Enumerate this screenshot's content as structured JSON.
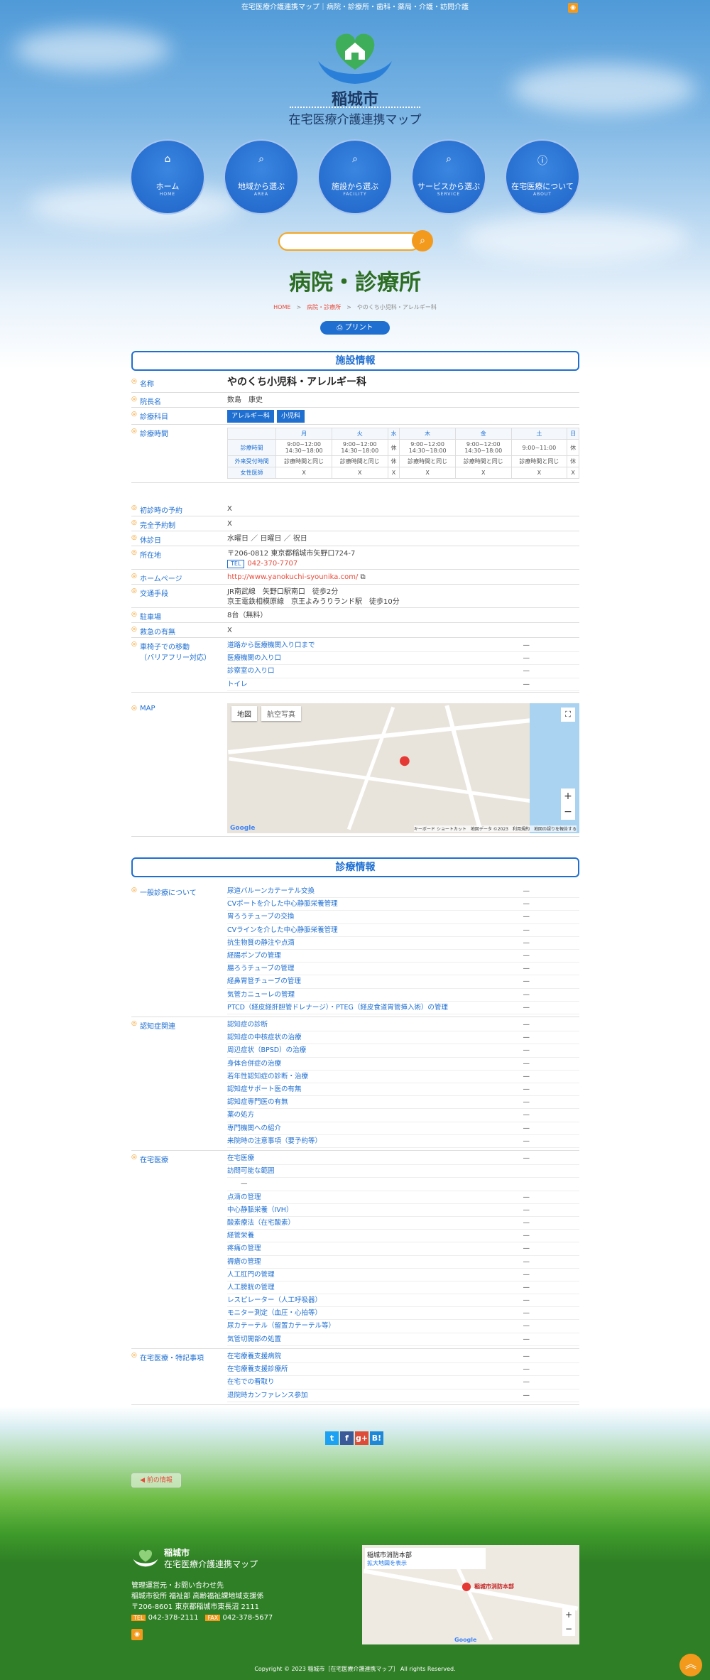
{
  "header": {
    "tagline": "在宅医療介護連携マップ｜病院・診療所・歯科・薬局・介護・訪問介護",
    "city": "稲城市",
    "site": "在宅医療介護連携マップ"
  },
  "nav": [
    {
      "label": "ホーム",
      "en": "HOME",
      "icon": "home-icon"
    },
    {
      "label": "地域から選ぶ",
      "en": "AREA",
      "icon": "search-icon"
    },
    {
      "label": "施設から選ぶ",
      "en": "FACILITY",
      "icon": "search-icon"
    },
    {
      "label": "サービスから選ぶ",
      "en": "SERVICE",
      "icon": "search-icon"
    },
    {
      "label": "在宅医療について",
      "en": "ABOUT",
      "icon": "info-icon"
    }
  ],
  "page_title": "病院・診療所",
  "breadcrumb": {
    "home": "HOME",
    "sep": ">",
    "category": "病院・診療所",
    "current": "やのくち小児科・アレルギー科"
  },
  "print_label": "プリント",
  "facility": {
    "heading": "施設情報",
    "name_label": "名称",
    "name": "やのくち小児科・アレルギー科",
    "head_label": "院長名",
    "head": "数島　康史",
    "dept_label": "診療科目",
    "depts": [
      "アレルギー科",
      "小児科"
    ],
    "hours_label": "診療時間",
    "hours_cols": [
      "",
      "月",
      "火",
      "水",
      "木",
      "金",
      "土",
      "日"
    ],
    "hours_rows": [
      [
        "診療時間",
        "9:00~12:00\n14:30~18:00",
        "9:00~12:00\n14:30~18:00",
        "休",
        "9:00~12:00\n14:30~18:00",
        "9:00~12:00\n14:30~18:00",
        "9:00~11:00",
        "休"
      ],
      [
        "外来受付時間",
        "診療時間と同じ",
        "診療時間と同じ",
        "休",
        "診療時間と同じ",
        "診療時間と同じ",
        "診療時間と同じ",
        "休"
      ],
      [
        "女性医師",
        "X",
        "X",
        "X",
        "X",
        "X",
        "X",
        "X"
      ]
    ],
    "first_label": "初診時の予約",
    "first": "X",
    "reserve_label": "完全予約制",
    "reserve": "X",
    "holiday_label": "休診日",
    "holiday": "水曜日 ／ 日曜日 ／ 祝日",
    "addr_label": "所在地",
    "addr": "〒206-0812 東京都稲城市矢野口724-7",
    "tel_tag": "TEL",
    "tel": "042-370-7707",
    "hp_label": "ホームページ",
    "hp": "http://www.yanokuchi-syounika.com/",
    "access_label": "交通手段",
    "access1": "JR南武線　矢野口駅南口　徒歩2分",
    "access2": "京王電鉄相模原線　京王よみうりランド駅　徒歩10分",
    "parking_label": "駐車場",
    "parking": "8台（無料）",
    "emergency_label": "救急の有無",
    "emergency": "X",
    "bf_label": "車椅子での移動",
    "bf_label2": "（バリアフリー対応）",
    "bf_items": [
      "道路から医療機関入り口まで",
      "医療機関の入り口",
      "診察室の入り口",
      "トイレ"
    ],
    "map_label": "MAP",
    "map_tab1": "地図",
    "map_tab2": "航空写真",
    "map_footer": "キーボード ショートカット　地図データ ©2023　利用規約　地図の誤りを報告する"
  },
  "medical": {
    "heading": "診療情報",
    "groups": [
      {
        "label": "一般診療について",
        "items": [
          "尿道バルーンカテーテル交換",
          "CVポートを介した中心静脈栄養管理",
          "胃ろうチューブの交換",
          "CVラインを介した中心静脈栄養管理",
          "抗生物質の静注や点滴",
          "経腸ポンプの管理",
          "腸ろうチューブの管理",
          "経鼻胃管チューブの管理",
          "気管カニューレの管理",
          "PTCD（経皮経肝胆管ドレナージ）・PTEG（経皮食道胃管挿入術）の管理"
        ]
      },
      {
        "label": "認知症関連",
        "items": [
          "認知症の診断",
          "認知症の中核症状の治療",
          "周辺症状（BPSD）の治療",
          "身体合併症の治療",
          "若年性認知症の診断・治療",
          "認知症サポート医の有無",
          "認知症専門医の有無",
          "薬の処方",
          "専門機関への紹介",
          "来院時の注意事項（要予約等）"
        ]
      },
      {
        "label": "在宅医療",
        "items": [
          "在宅医療",
          "訪問可能な範囲",
          "　　—",
          "点滴の管理",
          "中心静脈栄養（IVH）",
          "酸素療法（在宅酸素）",
          "経管栄養",
          "疼痛の管理",
          "褥瘡の管理",
          "人工肛門の管理",
          "人工膀胱の管理",
          "レスピレーター（人工呼吸器）",
          "モニター測定（血圧・心拍等）",
          "尿カテーテル（留置カテーテル等）",
          "気管切開部の処置"
        ]
      },
      {
        "label": "在宅医療・特記事項",
        "items": [
          "在宅療養支援病院",
          "在宅療養支援診療所",
          "在宅での看取り",
          "退院時カンファレンス参加"
        ]
      }
    ],
    "dash": "—"
  },
  "share": [
    "t",
    "f",
    "g+",
    "B!"
  ],
  "prev_label": "前の情報",
  "footer": {
    "city": "稲城市",
    "site": "在宅医療介護連携マップ",
    "l1": "管理運営元・お問い合わせ先",
    "l2": "稲城市役所 福祉部 高齢福祉課地域支援係",
    "l3": "〒206-8601 東京都稲城市東長沼 2111",
    "tel_tag": "TEL",
    "tel": "042-378-2111",
    "fax_tag": "FAX",
    "fax": "042-378-5677",
    "map_title": "稲城市消防本部",
    "map_link": "拡大地図を表示",
    "map_pin": "稲城市消防本部"
  },
  "copyright": "Copyright © 2023 稲城市［在宅医療介護連携マップ］ All rights Reserved."
}
